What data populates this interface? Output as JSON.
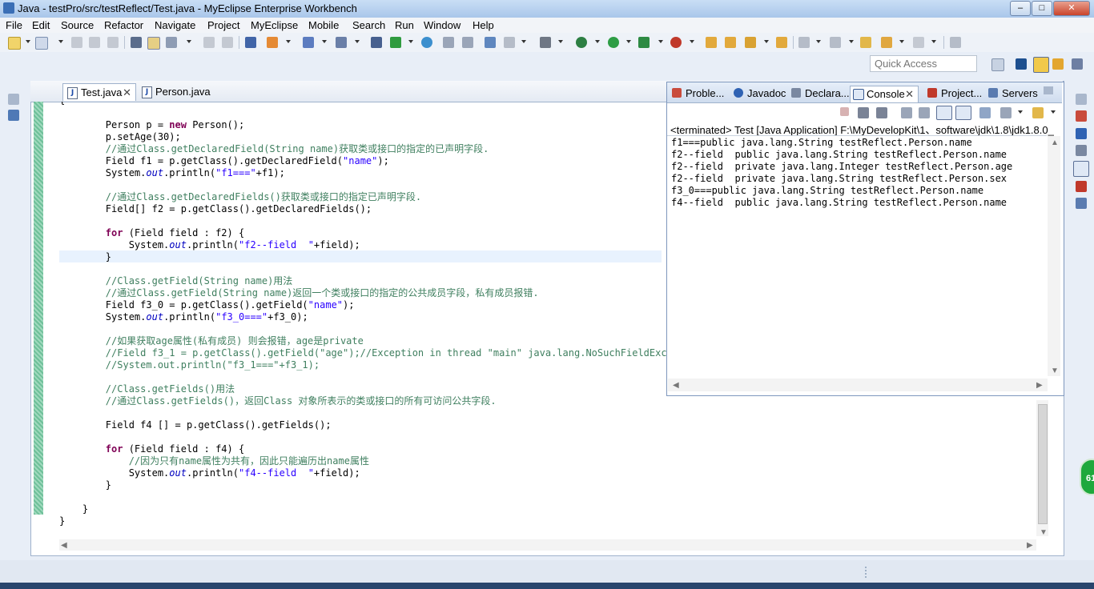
{
  "window": {
    "title": "Java - testPro/src/testReflect/Test.java - MyEclipse Enterprise Workbench",
    "minimize": "‒",
    "maximize": "□",
    "close": "✕"
  },
  "menu": [
    "File",
    "Edit",
    "Source",
    "Refactor",
    "Navigate",
    "Project",
    "MyEclipse",
    "Mobile",
    "Search",
    "Run",
    "Window",
    "Help"
  ],
  "quick_access": {
    "placeholder": "Quick Access"
  },
  "editor": {
    "tabs": [
      {
        "label": "Test.java",
        "close": "✕",
        "icon": "J"
      },
      {
        "label": "Person.java",
        "icon": "J"
      }
    ],
    "fragment": "{",
    "code": [
      [
        {
          "t": "        Person p = ",
          "c": ""
        },
        {
          "t": "new",
          "c": "kw"
        },
        {
          "t": " Person();",
          "c": ""
        }
      ],
      [
        {
          "t": "        p.setAge(30);",
          "c": ""
        }
      ],
      [
        {
          "t": "        //通过Class.getDeclaredField(String name)获取类或接口的指定的已声明字段.",
          "c": "cm"
        }
      ],
      [
        {
          "t": "        Field f1 = p.getClass().getDeclaredField(",
          "c": ""
        },
        {
          "t": "\"name\"",
          "c": "str"
        },
        {
          "t": ");",
          "c": ""
        }
      ],
      [
        {
          "t": "        System.",
          "c": ""
        },
        {
          "t": "out",
          "c": "it"
        },
        {
          "t": ".println(",
          "c": ""
        },
        {
          "t": "\"f1===\"",
          "c": "str"
        },
        {
          "t": "+f1);",
          "c": ""
        }
      ],
      [],
      [
        {
          "t": "        //通过Class.getDeclaredFields()获取类或接口的指定已声明字段.",
          "c": "cm"
        }
      ],
      [
        {
          "t": "        Field[] f2 = p.getClass().getDeclaredFields();",
          "c": ""
        }
      ],
      [],
      [
        {
          "t": "        ",
          "c": ""
        },
        {
          "t": "for",
          "c": "kw"
        },
        {
          "t": " (Field field : f2) {",
          "c": ""
        }
      ],
      [
        {
          "t": "            System.",
          "c": ""
        },
        {
          "t": "out",
          "c": "it"
        },
        {
          "t": ".println(",
          "c": ""
        },
        {
          "t": "\"f2--field  \"",
          "c": "str"
        },
        {
          "t": "+field);",
          "c": ""
        }
      ],
      [
        {
          "t": "        }",
          "c": ""
        }
      ],
      [],
      [
        {
          "t": "        //Class.getField(String name)用法",
          "c": "cm"
        }
      ],
      [
        {
          "t": "        //通过Class.getField(String name)返回一个类或接口的指定的公共成员字段，私有成员报错.",
          "c": "cm"
        }
      ],
      [
        {
          "t": "        Field f3_0 = p.getClass().getField(",
          "c": ""
        },
        {
          "t": "\"name\"",
          "c": "str"
        },
        {
          "t": ");",
          "c": ""
        }
      ],
      [
        {
          "t": "        System.",
          "c": ""
        },
        {
          "t": "out",
          "c": "it"
        },
        {
          "t": ".println(",
          "c": ""
        },
        {
          "t": "\"f3_0===\"",
          "c": "str"
        },
        {
          "t": "+f3_0);",
          "c": ""
        }
      ],
      [],
      [
        {
          "t": "        //如果获取age属性(私有成员) 则会报错，age是private",
          "c": "cm"
        }
      ],
      [
        {
          "t": "        //Field f3_1 = p.getClass().getField(\"age\");//Exception in thread \"main\" java.lang.NoSuchFieldExcept",
          "c": "cm"
        }
      ],
      [
        {
          "t": "        //System.out.println(\"f3_1===\"+f3_1);",
          "c": "cm"
        }
      ],
      [],
      [
        {
          "t": "        //Class.getFields()用法",
          "c": "cm"
        }
      ],
      [
        {
          "t": "        //通过Class.getFields()，返回Class 对象所表示的类或接口的所有可访问公共字段.",
          "c": "cm"
        }
      ],
      [],
      [
        {
          "t": "        Field f4 [] = p.getClass().getFields();",
          "c": ""
        }
      ],
      [],
      [
        {
          "t": "        ",
          "c": ""
        },
        {
          "t": "for",
          "c": "kw"
        },
        {
          "t": " (Field field : f4) {",
          "c": ""
        }
      ],
      [
        {
          "t": "            //因为只有name属性为共有，因此只能遍历出name属性",
          "c": "cm"
        }
      ],
      [
        {
          "t": "            System.",
          "c": ""
        },
        {
          "t": "out",
          "c": "it"
        },
        {
          "t": ".println(",
          "c": ""
        },
        {
          "t": "\"f4--field  \"",
          "c": "str"
        },
        {
          "t": "+field);",
          "c": ""
        }
      ],
      [
        {
          "t": "        }",
          "c": ""
        }
      ],
      [],
      [
        {
          "t": "    }",
          "c": ""
        }
      ],
      [
        {
          "t": "}",
          "c": ""
        }
      ]
    ]
  },
  "console": {
    "tabs": [
      "Proble...",
      "Javadoc",
      "Declara...",
      "Console",
      "Project...",
      "Servers"
    ],
    "terminated": "<terminated> Test [Java Application] F:\\MyDevelopKit\\1、software\\jdk\\1.8\\jdk1.8.0_",
    "output": [
      "f1===public java.lang.String testReflect.Person.name",
      "f2--field  public java.lang.String testReflect.Person.name",
      "f2--field  private java.lang.Integer testReflect.Person.age",
      "f2--field  private java.lang.String testReflect.Person.sex",
      "f3_0===public java.lang.String testReflect.Person.name",
      "f4--field  public java.lang.String testReflect.Person.name"
    ]
  },
  "badge": {
    "text": "61"
  },
  "colors": {
    "accent": "#3b6fb6",
    "keyword": "#7f0055",
    "string": "#2a00ff",
    "comment": "#3f7f5f"
  }
}
